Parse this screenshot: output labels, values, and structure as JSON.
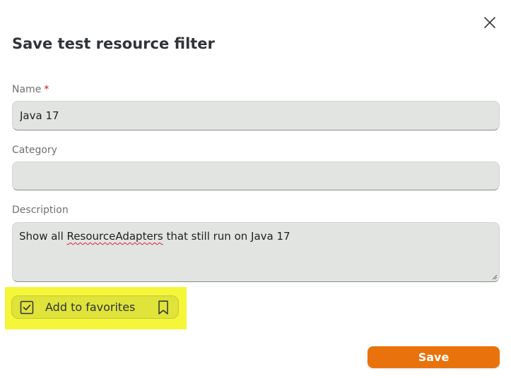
{
  "dialog": {
    "title": "Save test resource filter",
    "close_icon": "close-icon"
  },
  "fields": {
    "name": {
      "label": "Name",
      "required_marker": "*",
      "value": "Java 17"
    },
    "category": {
      "label": "Category",
      "value": ""
    },
    "description": {
      "label": "Description",
      "value_prefix": "Show all ",
      "value_misspelled": "ResourceAdapters",
      "value_suffix": " that still run on Java 17"
    }
  },
  "favorites": {
    "label": "Add to favorites",
    "checked": true,
    "check_icon": "checkbox-checked-icon",
    "bookmark_icon": "bookmark-icon"
  },
  "actions": {
    "save_label": "Save"
  },
  "colors": {
    "accent": "#e9720c",
    "highlight": "#f5f53a",
    "required": "#c9190b"
  }
}
